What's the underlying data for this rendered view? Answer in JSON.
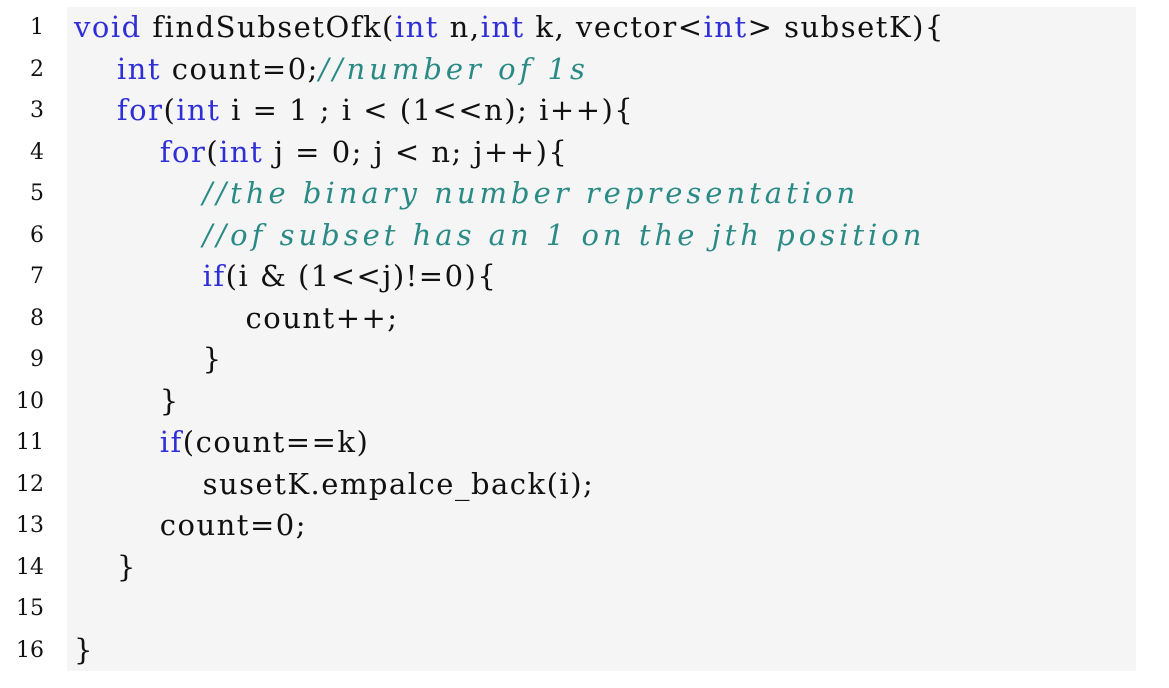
{
  "listing": {
    "lines": [
      {
        "number": "1",
        "tokens": [
          {
            "t": "void",
            "k": "kw"
          },
          {
            "t": " findSubsetOfk(",
            "k": "tx"
          },
          {
            "t": "int",
            "k": "kw"
          },
          {
            "t": " n,",
            "k": "tx"
          },
          {
            "t": "int",
            "k": "kw"
          },
          {
            "t": " k, vector<",
            "k": "tx"
          },
          {
            "t": "int",
            "k": "kw"
          },
          {
            "t": "> subsetK){",
            "k": "tx"
          }
        ]
      },
      {
        "number": "2",
        "tokens": [
          {
            "t": "    ",
            "k": "tx"
          },
          {
            "t": "int",
            "k": "kw"
          },
          {
            "t": " count=0;",
            "k": "tx"
          },
          {
            "t": "//number of 1s",
            "k": "cm"
          }
        ]
      },
      {
        "number": "3",
        "tokens": [
          {
            "t": "    ",
            "k": "tx"
          },
          {
            "t": "for",
            "k": "kw"
          },
          {
            "t": "(",
            "k": "tx"
          },
          {
            "t": "int",
            "k": "kw"
          },
          {
            "t": " i = 1 ; i < (1<<n); i++){",
            "k": "tx"
          }
        ]
      },
      {
        "number": "4",
        "tokens": [
          {
            "t": "        ",
            "k": "tx"
          },
          {
            "t": "for",
            "k": "kw"
          },
          {
            "t": "(",
            "k": "tx"
          },
          {
            "t": "int",
            "k": "kw"
          },
          {
            "t": " j = 0; j < n; j++){",
            "k": "tx"
          }
        ]
      },
      {
        "number": "5",
        "tokens": [
          {
            "t": "            ",
            "k": "tx"
          },
          {
            "t": "//the binary number representation",
            "k": "cm"
          }
        ]
      },
      {
        "number": "6",
        "tokens": [
          {
            "t": "            ",
            "k": "tx"
          },
          {
            "t": "//of subset has an 1 on the jth position",
            "k": "cm"
          }
        ]
      },
      {
        "number": "7",
        "tokens": [
          {
            "t": "            ",
            "k": "tx"
          },
          {
            "t": "if",
            "k": "kw"
          },
          {
            "t": "(i & (1<<j)!=0){",
            "k": "tx"
          }
        ]
      },
      {
        "number": "8",
        "tokens": [
          {
            "t": "                count++;",
            "k": "tx"
          }
        ]
      },
      {
        "number": "9",
        "tokens": [
          {
            "t": "            }",
            "k": "tx"
          }
        ]
      },
      {
        "number": "10",
        "tokens": [
          {
            "t": "        }",
            "k": "tx"
          }
        ]
      },
      {
        "number": "11",
        "tokens": [
          {
            "t": "        ",
            "k": "tx"
          },
          {
            "t": "if",
            "k": "kw"
          },
          {
            "t": "(count==k)",
            "k": "tx"
          }
        ]
      },
      {
        "number": "12",
        "tokens": [
          {
            "t": "            susetK.empalce_back(i);",
            "k": "tx"
          }
        ]
      },
      {
        "number": "13",
        "tokens": [
          {
            "t": "        count=0;",
            "k": "tx"
          }
        ]
      },
      {
        "number": "14",
        "tokens": [
          {
            "t": "    }",
            "k": "tx"
          }
        ]
      },
      {
        "number": "15",
        "tokens": []
      },
      {
        "number": "16",
        "tokens": [
          {
            "t": "}",
            "k": "tx"
          }
        ]
      }
    ]
  },
  "colors": {
    "keyword": "#2f2fd7",
    "comment": "#2a8a86",
    "text": "#111111",
    "background": "#f5f5f5"
  }
}
